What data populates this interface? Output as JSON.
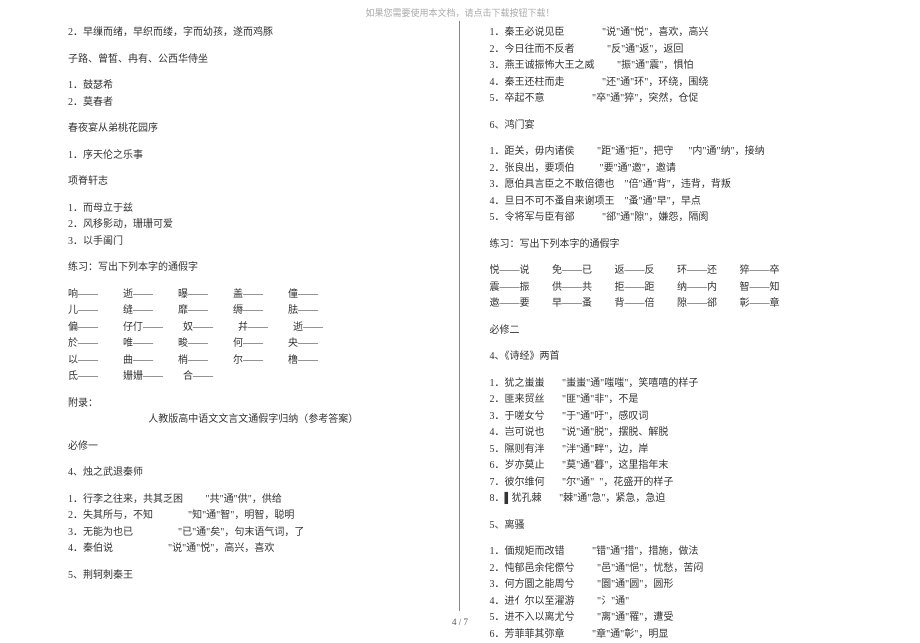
{
  "top_notice": "如果您需要使用本文档，请点击下载按钮下载！",
  "footer": "4 / 7",
  "left": {
    "l1": "2．早缫而绪，早织而缕，字而幼孩，遂而鸡豚",
    "l2": "子路、曾皙、冉有、公西华侍坐",
    "l3": "1．鼓瑟希",
    "l4": "2．莫春者",
    "l5": "春夜宴从弟桃花园序",
    "l6": "1．序天伦之乐事",
    "l7": "项脊轩志",
    "l8": "1．而母立于兹",
    "l9": "2．风移影动，珊珊可爱",
    "l10": "3．以手阖门",
    "l11": "练习：写出下列本字的通假字",
    "tbl": [
      "响——          逝——          曝——          盖——          僮——",
      "儿——          缝——          靡——          缛——          胠——",
      "偏——          仔仃——        奴——          幷——          逝——",
      "於——          唯——          畯——          何——          央——",
      "以——          曲——          梢——          尔——          橹——",
      "氐——          姗姗——        合——"
    ],
    "l12": "附录：",
    "l13": "人教版高中语文文言文通假字归纳（参考答案）",
    "l14": "必修一",
    "l15": "4、烛之武退秦师",
    "ans1": [
      "1．行李之往来，共其乏困         \"共\"通\"供\"，供给",
      "2．失其所与，不知              \"知\"通\"智\"，明智，聪明",
      "3．无能为也已                  \"已\"通\"矣\"，句末语气词，了",
      "4．秦伯说                      \"说\"通\"悦\"，高兴，喜欢"
    ],
    "l16": "5、荆轲刺秦王"
  },
  "right": {
    "ans2": [
      "1．秦王必说见臣               \"说\"通\"悦\"，喜欢，高兴",
      "2．今日往而不反者             \"反\"通\"返\"，返回",
      "3．燕王诚振怖大王之威         \"振\"通\"震\"，惧怕",
      "4．秦王还柱而走               \"还\"通\"环\"，环绕，围绕",
      "5．卒起不意                   \"卒\"通\"猝\"，突然，仓促"
    ],
    "r1": "6、鸿门宴",
    "ans3": [
      "1．距关，毋内诸侯         \"距\"通\"拒\"，把守      \"内\"通\"纳\"，接纳",
      "2．张良出，要项伯          \"要\"通\"邀\"，邀请",
      "3．愿伯具言臣之不敢倍德也    \"倍\"通\"背\"，违背，背叛",
      "4．旦日不可不蚤自来谢项王    \"蚤\"通\"早\"，早点",
      "5．令将军与臣有郤           \"郤\"通\"隙\"，嫌怨，隔阂"
    ],
    "r2": "练习：写出下列本字的通假字",
    "tbl2": [
      "悦——说         免——已         返——反         环——还         猝——卒",
      "震——振         供——共         拒——距         纳——内         智——知",
      "邀——要         早——蚤         背——倍         隙——郤         彰——章"
    ],
    "r3": "必修二",
    "r4": "4、《诗经》两首",
    "ans4": [
      "1．犹之蚩蚩       \"蚩蚩\"通\"嗤嗤\"，笑嘻嘻的样子",
      "2．匪来贸丝       \"匪\"通\"非\"，不是",
      "3．于嗟女兮       \"于\"通\"吁\"，感叹词",
      "4．岂可说也       \"说\"通\"脱\"，摆脱、解脱",
      "5．隰则有泮       \"泮\"通\"畔\"，边，岸",
      "6．岁亦莫止       \"莫\"通\"暮\"，这里指年末",
      "7．彼尔维何       \"尔\"通\"  \"，花盛开的样子",
      "8．▌犹孔棘       \"棘\"通\"急\"，紧急，急迫"
    ],
    "r5": "5、离骚",
    "ans5": [
      "1．偭规矩而改错           \"错\"通\"措\"，措施，做法",
      "2．忳郁邑余侘傺兮         \"邑\"通\"悒\"，忧愁，苦闷",
      "3．何方圜之能周兮         \"圜\"通\"圆\"，圆形",
      "4．进亻尔以至濯游         \"氵\"通\"",
      "5．进不入以离尤兮         \"离\"通\"罹\"，遭受",
      "6．芳菲菲其弥章           \"章\"通\"彰\"，明显"
    ]
  }
}
